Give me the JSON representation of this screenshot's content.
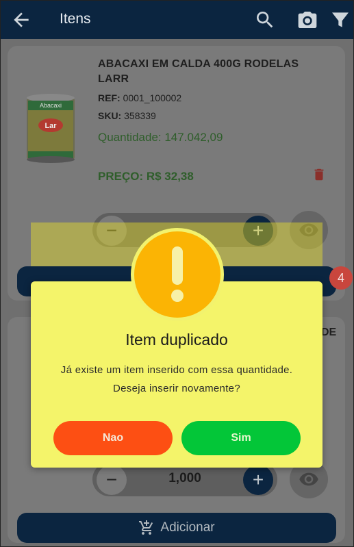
{
  "appbar": {
    "title": "Itens",
    "icons": [
      "arrow-back-icon",
      "search-icon",
      "camera-icon",
      "filter-icon"
    ]
  },
  "products": [
    {
      "name": "ABACAXI EM CALDA 400G RODELAS LARR",
      "ref_label": "REF:",
      "ref_value": "0001_100002",
      "sku_label": "SKU:",
      "sku_value": "358339",
      "quantity_text": "Quantidade: 147.042,09",
      "price_text": "PREÇO: R$ 32,38",
      "image_label": "Abacaxi",
      "brand_label": "Lar"
    },
    {
      "name_partial": "DE",
      "stepper_value": "1,000",
      "add_label": "Adicionar"
    }
  ],
  "cart_badge": "4",
  "dialog": {
    "title": "Item duplicado",
    "message_line1": "Já existe um item inserido com essa quantidade.",
    "message_line2": "Deseja inserir novamente?",
    "no_label": "Nao",
    "yes_label": "Sim",
    "icon": "warning-exclamation-icon"
  },
  "colors": {
    "appbar_bg": "#0b2540",
    "dialog_bg": "#f4f46a",
    "warning": "#fbb404",
    "no_button": "#fd4f13",
    "yes_button": "#03c638",
    "badge": "#c9463d"
  }
}
